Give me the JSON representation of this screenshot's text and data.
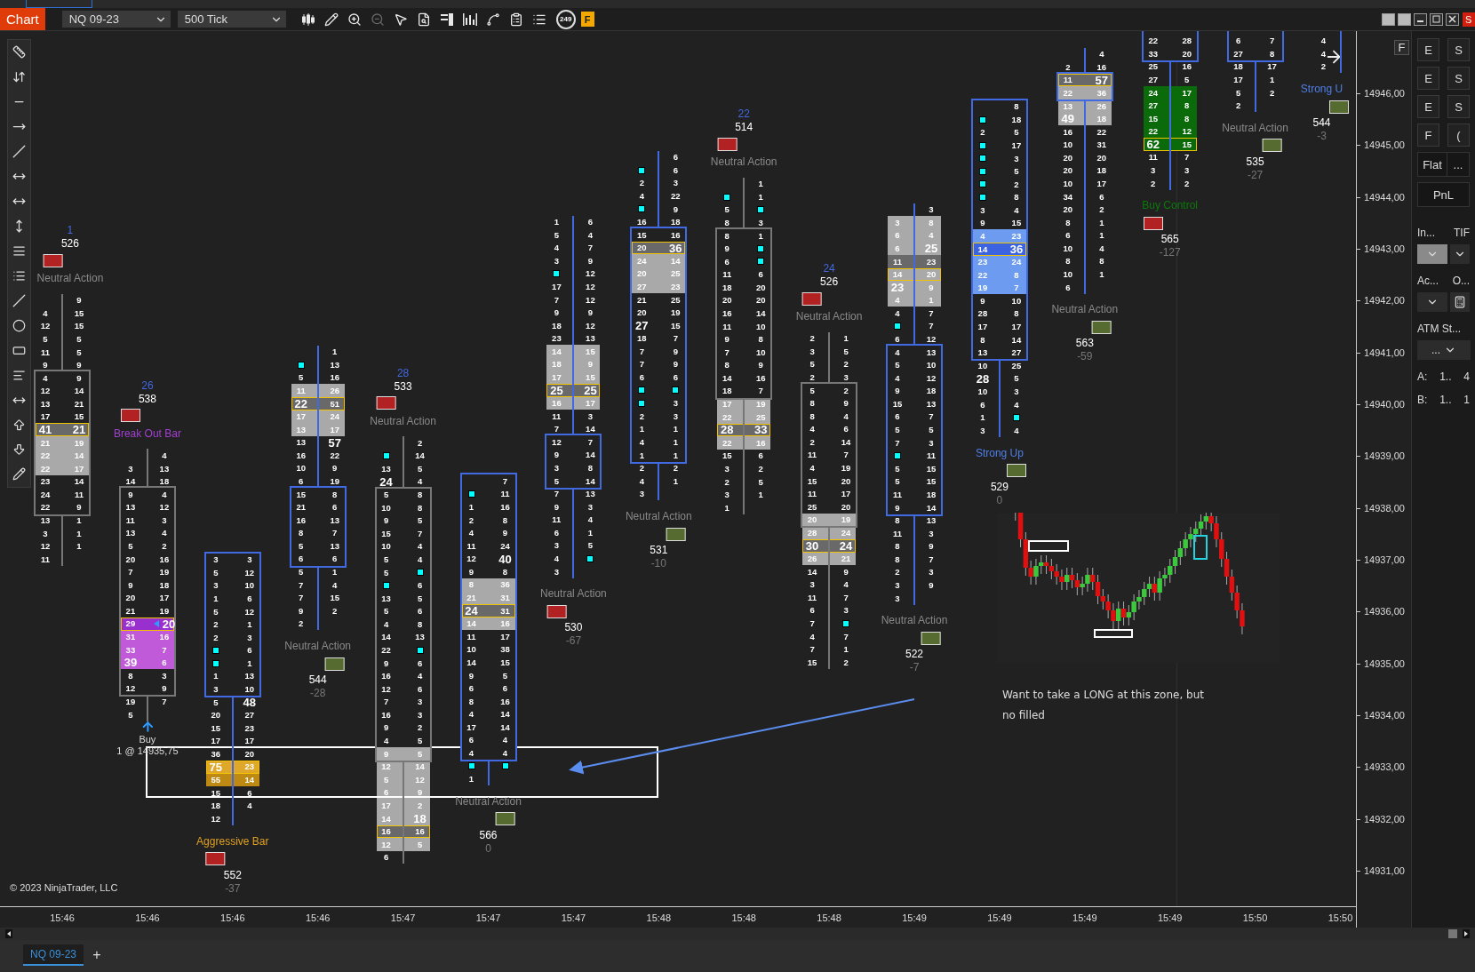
{
  "window": {
    "corner_label": "S"
  },
  "toolbar": {
    "title": "Chart",
    "instrument": "NQ 09-23",
    "interval": "500 Tick",
    "bar_counter": "249",
    "flag": "F"
  },
  "chart": {
    "bars": [
      {
        "up": false,
        "upper": [
          {
            "ask": "9"
          },
          {
            "bid": "4",
            "ask": "15"
          },
          {
            "bid": "12",
            "ask": "15"
          },
          {
            "bid": "5",
            "ask": "5"
          },
          {
            "bid": "11",
            "ask": "5"
          },
          {
            "bid": "9",
            "ask": "9"
          }
        ],
        "body": [
          {
            "bid": "4",
            "ask": "9"
          },
          {
            "bid": "12",
            "ask": "14"
          },
          {
            "bid": "13",
            "ask": "21"
          },
          {
            "bid": "17",
            "ask": "15"
          },
          {
            "bid": "41",
            "ask": "21",
            "kind": "poc",
            "bid_bold": true,
            "ask_bold": true
          },
          {
            "bid": "21",
            "ask": "19",
            "kind": "light"
          },
          {
            "bid": "22",
            "ask": "14",
            "kind": "light"
          },
          {
            "bid": "22",
            "ask": "17",
            "kind": "light"
          },
          {
            "bid": "23",
            "ask": "14"
          },
          {
            "bid": "24",
            "ask": "11"
          },
          {
            "bid": "22",
            "ask": "9"
          }
        ],
        "lower": [
          {
            "bid": "13",
            "ask": "1"
          },
          {
            "bid": "3",
            "ask": "1"
          },
          {
            "bid": "12",
            "ask": "1"
          },
          {
            "bid": "11"
          }
        ],
        "above": {
          "count": "1",
          "volume": "526",
          "color": "#b22222",
          "label": {
            "text": "Neutral Action",
            "color": "#8a8a8a"
          }
        }
      },
      {
        "up": false,
        "upper": [
          {
            "ask": "4"
          },
          {
            "bid": "3",
            "ask": "13"
          },
          {
            "bid": "14",
            "ask": "18"
          }
        ],
        "body": [
          {
            "bid": "9",
            "ask": "4"
          },
          {
            "bid": "13",
            "ask": "12"
          },
          {
            "bid": "11",
            "ask": "3"
          },
          {
            "bid": "13",
            "ask": "4"
          },
          {
            "bid": "5",
            "ask": "2"
          },
          {
            "bid": "20",
            "ask": "16"
          },
          {
            "bid": "7",
            "ask": "19"
          },
          {
            "bid": "9",
            "ask": "18"
          },
          {
            "bid": "20",
            "ask": "17"
          },
          {
            "bid": "21",
            "ask": "19"
          },
          {
            "bid": "29",
            "ask": "20",
            "kind": "purple_poc",
            "ask_bold": true,
            "pointer": true
          },
          {
            "bid": "31",
            "ask": "16",
            "kind": "purple"
          },
          {
            "bid": "33",
            "ask": "7",
            "kind": "purple"
          },
          {
            "bid": "39",
            "ask": "6",
            "kind": "purple",
            "bid_bold": true
          },
          {
            "bid": "8",
            "ask": "3"
          },
          {
            "bid": "12",
            "ask": "9"
          }
        ],
        "lower": [
          {
            "bid": "19",
            "ask": "7"
          },
          {
            "bid": "5"
          }
        ],
        "above": {
          "count": "26",
          "volume": "538",
          "color": "#b22222",
          "label": {
            "text": "Break Out Bar",
            "color": "#a040d0"
          }
        },
        "order": {
          "side": "Buy",
          "fill": "1 @ 14935,75"
        }
      },
      {
        "up": true,
        "body": [
          {
            "bid": "3",
            "ask": "3"
          },
          {
            "bid": "5",
            "ask": "12"
          },
          {
            "bid": "3",
            "ask": "10"
          },
          {
            "bid": "1",
            "ask": "6"
          },
          {
            "bid": "5",
            "ask": "12"
          },
          {
            "bid": "2",
            "ask": "1"
          },
          {
            "bid": "2",
            "ask": "3"
          },
          {
            "bid_marker": true,
            "ask": "6"
          },
          {
            "bid_marker": true,
            "ask": "1"
          },
          {
            "bid": "1",
            "ask": "13"
          },
          {
            "bid": "3",
            "ask": "10"
          }
        ],
        "lower": [
          {
            "bid": "5",
            "ask": "48",
            "ask_bold": true
          },
          {
            "bid": "20",
            "ask": "27"
          },
          {
            "bid": "15",
            "ask": "23"
          },
          {
            "bid": "17",
            "ask": "17"
          },
          {
            "bid": "36",
            "ask": "20"
          },
          {
            "bid": "75",
            "ask": "23",
            "kind": "orange_poc",
            "bid_bold": true
          },
          {
            "bid": "55",
            "ask": "14",
            "kind": "orange"
          },
          {
            "bid": "15",
            "ask": "6"
          },
          {
            "bid": "18",
            "ask": "4"
          },
          {
            "bid": "12"
          }
        ],
        "below": {
          "label": {
            "text": "Aggressive Bar",
            "color": "#e0a020"
          },
          "color": "#b22222",
          "volume": "552",
          "delta": "-37"
        }
      },
      {
        "up": true,
        "upper": [
          {
            "ask": "1"
          },
          {
            "bid_marker": true,
            "ask": "13"
          },
          {
            "bid": "5",
            "ask": "16"
          },
          {
            "bid": "11",
            "ask": "26",
            "kind": "light"
          },
          {
            "bid": "22",
            "ask": "51",
            "kind": "poc",
            "bid_bold": true
          },
          {
            "bid": "17",
            "ask": "24",
            "kind": "light"
          },
          {
            "bid": "13",
            "ask": "17",
            "kind": "light"
          },
          {
            "bid": "13",
            "ask": "57",
            "ask_bold": true
          },
          {
            "bid": "16",
            "ask": "22"
          },
          {
            "bid": "10",
            "ask": "9"
          },
          {
            "bid": "6",
            "ask": "19"
          }
        ],
        "body": [
          {
            "bid": "15",
            "ask": "8"
          },
          {
            "bid": "21",
            "ask": "6"
          },
          {
            "bid": "16",
            "ask": "13"
          },
          {
            "bid": "8",
            "ask": "7"
          },
          {
            "bid": "5",
            "ask": "13"
          },
          {
            "bid": "6",
            "ask": "6"
          }
        ],
        "lower": [
          {
            "bid": "5",
            "ask": "1"
          },
          {
            "bid": "7",
            "ask": "4"
          },
          {
            "bid": "7",
            "ask": "15"
          },
          {
            "bid": "9",
            "ask": "2"
          },
          {
            "bid": "2"
          }
        ],
        "below": {
          "label": {
            "text": "Neutral Action",
            "color": "#8a8a8a"
          },
          "color": "#556b2f",
          "volume": "544",
          "delta": "-28"
        }
      },
      {
        "up": false,
        "upper": [
          {
            "ask": "2"
          },
          {
            "bid_marker": true,
            "ask": "14"
          },
          {
            "bid": "13",
            "ask": "5"
          },
          {
            "bid": "24",
            "ask": "4",
            "bid_bold": true
          }
        ],
        "body": [
          {
            "bid": "5",
            "ask": "8"
          },
          {
            "bid": "10",
            "ask": "8"
          },
          {
            "bid": "9",
            "ask": "5"
          },
          {
            "bid": "15",
            "ask": "7"
          },
          {
            "bid": "10",
            "ask": "4"
          },
          {
            "bid": "5",
            "ask": "4"
          },
          {
            "bid": "5",
            "ask_marker": true
          },
          {
            "bid_marker": true,
            "ask": "6"
          },
          {
            "bid": "13",
            "ask": "5"
          },
          {
            "bid": "5",
            "ask": "6"
          },
          {
            "bid": "4",
            "ask": "8"
          },
          {
            "bid": "14",
            "ask": "13"
          },
          {
            "bid": "22",
            "ask_marker": true
          },
          {
            "bid": "9",
            "ask": "6"
          },
          {
            "bid": "16",
            "ask": "4"
          },
          {
            "bid": "12",
            "ask": "6"
          },
          {
            "bid": "7",
            "ask": "3"
          },
          {
            "bid": "16",
            "ask": "3"
          },
          {
            "bid": "9",
            "ask": "2"
          },
          {
            "bid": "4",
            "ask": "5"
          },
          {
            "bid": "9",
            "ask": "5",
            "kind": "light"
          }
        ],
        "lower": [
          {
            "bid": "12",
            "ask": "14",
            "kind": "light"
          },
          {
            "bid": "5",
            "ask": "12",
            "kind": "light"
          },
          {
            "bid": "6",
            "ask": "9",
            "kind": "light"
          },
          {
            "bid": "17",
            "ask": "2",
            "kind": "light"
          },
          {
            "bid": "14",
            "ask": "18",
            "kind": "light",
            "ask_bold": true
          },
          {
            "bid": "16",
            "ask": "16",
            "kind": "poc"
          },
          {
            "bid": "12",
            "ask": "5",
            "kind": "light"
          },
          {
            "bid": "6"
          }
        ],
        "above": {
          "count": "28",
          "volume": "533",
          "color": "#b22222",
          "label": {
            "text": "Neutral Action",
            "color": "#8a8a8a"
          }
        }
      },
      {
        "up": true,
        "body": [
          {
            "ask": "7"
          },
          {
            "bid_marker": true,
            "ask": "11"
          },
          {
            "bid": "1",
            "ask": "16"
          },
          {
            "bid": "2",
            "ask": "8"
          },
          {
            "bid": "4",
            "ask": "9"
          },
          {
            "bid": "11",
            "ask": "24"
          },
          {
            "bid": "12",
            "ask": "40",
            "ask_bold": true
          },
          {
            "bid": "9",
            "ask": "8"
          },
          {
            "bid": "8",
            "ask": "36",
            "kind": "light"
          },
          {
            "bid": "21",
            "ask": "31",
            "kind": "light"
          },
          {
            "bid": "24",
            "ask": "31",
            "kind": "poc",
            "bid_bold": true
          },
          {
            "bid": "14",
            "ask": "16",
            "kind": "light"
          },
          {
            "bid": "11",
            "ask": "17"
          },
          {
            "bid": "10",
            "ask": "38"
          },
          {
            "bid": "14",
            "ask": "15"
          },
          {
            "bid": "9",
            "ask": "5"
          },
          {
            "bid": "6",
            "ask": "6"
          },
          {
            "bid": "8",
            "ask": "16"
          },
          {
            "bid": "4",
            "ask": "14"
          },
          {
            "bid": "17",
            "ask": "14"
          },
          {
            "bid": "6",
            "ask": "4"
          },
          {
            "bid": "4",
            "ask": "4"
          }
        ],
        "lower": [
          {
            "bid_marker": true,
            "ask_marker": true
          },
          {
            "bid": "1"
          }
        ],
        "below": {
          "label": {
            "text": "Neutral Action",
            "color": "#8a8a8a"
          },
          "color": "#556b2f",
          "volume": "566",
          "delta": "0"
        }
      },
      {
        "up": true,
        "upper": [
          {
            "bid": "1",
            "ask": "6"
          },
          {
            "bid": "5",
            "ask": "4"
          },
          {
            "bid": "4",
            "ask": "7"
          },
          {
            "bid": "3",
            "ask": "9"
          },
          {
            "bid_marker": true,
            "ask": "12"
          },
          {
            "bid": "17",
            "ask": "12"
          },
          {
            "bid": "7",
            "ask": "12"
          },
          {
            "bid": "9",
            "ask": "9"
          },
          {
            "bid": "18",
            "ask": "12"
          },
          {
            "bid": "23",
            "ask": "13"
          },
          {
            "bid": "14",
            "ask": "15",
            "kind": "light"
          },
          {
            "bid": "18",
            "ask": "9",
            "kind": "light"
          },
          {
            "bid": "17",
            "ask": "15",
            "kind": "light"
          },
          {
            "bid": "25",
            "ask": "25",
            "kind": "poc",
            "bid_bold": true,
            "ask_bold": true
          },
          {
            "bid": "16",
            "ask": "17",
            "kind": "light"
          },
          {
            "bid": "11",
            "ask": "3"
          },
          {
            "bid": "7",
            "ask": "14"
          }
        ],
        "body": [
          {
            "bid": "12",
            "ask": "7"
          },
          {
            "bid": "9",
            "ask": "14"
          },
          {
            "bid": "3",
            "ask": "8"
          },
          {
            "bid": "5",
            "ask": "14"
          }
        ],
        "lower": [
          {
            "bid": "7",
            "ask": "13"
          },
          {
            "bid": "9",
            "ask": "3"
          },
          {
            "bid": "11",
            "ask": "4"
          },
          {
            "bid": "6",
            "ask": "1"
          },
          {
            "bid": "3",
            "ask": "5"
          },
          {
            "bid": "4",
            "ask_marker": true
          },
          {
            "bid": "3"
          }
        ],
        "below": {
          "label": {
            "text": "Neutral Action",
            "color": "#8a8a8a"
          },
          "color": "#b22222",
          "volume": "530",
          "delta": "-67"
        }
      },
      {
        "up": true,
        "upper": [
          {
            "ask": "6"
          },
          {
            "bid_marker": true,
            "ask": "6"
          },
          {
            "bid": "2",
            "ask": "3"
          },
          {
            "bid": "4",
            "ask": "22"
          },
          {
            "bid_marker": true,
            "ask": "9"
          },
          {
            "bid": "16",
            "ask": "18"
          }
        ],
        "body": [
          {
            "bid": "15",
            "ask": "16"
          },
          {
            "bid": "20",
            "ask": "36",
            "kind": "poc",
            "ask_bold": true
          },
          {
            "bid": "24",
            "ask": "14",
            "kind": "light"
          },
          {
            "bid": "20",
            "ask": "25",
            "kind": "light"
          },
          {
            "bid": "27",
            "ask": "23",
            "kind": "light"
          },
          {
            "bid": "21",
            "ask": "25"
          },
          {
            "bid": "20",
            "ask": "19"
          },
          {
            "bid": "27",
            "ask": "15",
            "bid_bold": true
          },
          {
            "bid": "18",
            "ask": "7"
          },
          {
            "bid": "7",
            "ask": "9"
          },
          {
            "bid": "7",
            "ask": "9"
          },
          {
            "bid": "6",
            "ask": "6"
          },
          {
            "bid_marker": true,
            "ask_marker": true
          },
          {
            "bid_marker": true,
            "ask": "3"
          },
          {
            "bid": "2",
            "ask": "3"
          },
          {
            "bid": "1",
            "ask": "1"
          },
          {
            "bid": "4",
            "ask": "1"
          },
          {
            "bid": "1",
            "ask": "1"
          }
        ],
        "lower": [
          {
            "bid": "2",
            "ask": "2"
          },
          {
            "bid": "4",
            "ask": "1"
          },
          {
            "bid": "3"
          }
        ],
        "below": {
          "label": {
            "text": "Neutral Action",
            "color": "#8a8a8a"
          },
          "color": "#556b2f",
          "volume": "531",
          "delta": "-10"
        }
      },
      {
        "up": false,
        "upper": [
          {
            "ask": "1"
          },
          {
            "bid_marker": true,
            "ask": "1"
          },
          {
            "bid": "5",
            "ask_marker": true
          },
          {
            "bid": "8",
            "ask": "3"
          }
        ],
        "body": [
          {
            "bid": "8",
            "ask": "1"
          },
          {
            "bid": "9",
            "ask_marker": true
          },
          {
            "bid": "6",
            "ask_marker": true
          },
          {
            "bid": "11",
            "ask": "6"
          },
          {
            "bid": "18",
            "ask": "20"
          },
          {
            "bid": "20",
            "ask": "20"
          },
          {
            "bid": "16",
            "ask": "14"
          },
          {
            "bid": "11",
            "ask": "10"
          },
          {
            "bid": "9",
            "ask": "8"
          },
          {
            "bid": "7",
            "ask": "10"
          },
          {
            "bid": "8",
            "ask": "9"
          },
          {
            "bid": "14",
            "ask": "16"
          },
          {
            "bid": "18",
            "ask": "7"
          }
        ],
        "lower": [
          {
            "bid": "17",
            "ask": "19",
            "kind": "light"
          },
          {
            "bid": "22",
            "ask": "25",
            "kind": "light"
          },
          {
            "bid": "28",
            "ask": "33",
            "kind": "poc",
            "bid_bold": true,
            "ask_bold": true
          },
          {
            "bid": "22",
            "ask": "16",
            "kind": "light"
          },
          {
            "bid": "15",
            "ask": "6"
          },
          {
            "bid": "3",
            "ask": "2"
          },
          {
            "bid": "2",
            "ask": "5"
          },
          {
            "bid": "3",
            "ask": "1"
          },
          {
            "bid": "1"
          }
        ],
        "above": {
          "count": "22",
          "volume": "514",
          "color": "#b22222",
          "label": {
            "text": "Neutral Action",
            "color": "#8a8a8a"
          }
        }
      },
      {
        "up": false,
        "upper": [
          {
            "bid": "2",
            "ask": "1"
          },
          {
            "bid": "3",
            "ask": "5"
          },
          {
            "bid": "5",
            "ask": "2"
          },
          {
            "bid": "2",
            "ask": "3"
          }
        ],
        "body": [
          {
            "bid": "5",
            "ask": "2"
          },
          {
            "bid": "8",
            "ask": "9"
          },
          {
            "bid": "8",
            "ask": "4"
          },
          {
            "bid": "4",
            "ask": "6"
          },
          {
            "bid": "2",
            "ask": "14"
          },
          {
            "bid": "11",
            "ask": "7"
          },
          {
            "bid": "4",
            "ask": "19"
          },
          {
            "bid": "15",
            "ask": "20"
          },
          {
            "bid": "11",
            "ask": "17"
          },
          {
            "bid": "25",
            "ask": "20"
          },
          {
            "bid": "20",
            "ask": "19",
            "kind": "light"
          }
        ],
        "lower": [
          {
            "bid": "28",
            "ask": "24",
            "kind": "light"
          },
          {
            "bid": "30",
            "ask": "24",
            "kind": "poc",
            "bid_bold": true,
            "ask_bold": true
          },
          {
            "bid": "26",
            "ask": "21",
            "kind": "light"
          },
          {
            "bid": "14",
            "ask": "9"
          },
          {
            "bid": "3",
            "ask": "4"
          },
          {
            "bid": "11",
            "ask": "7"
          },
          {
            "bid": "6",
            "ask": "3"
          },
          {
            "bid": "7",
            "ask_marker": true
          },
          {
            "bid": "4",
            "ask": "7"
          },
          {
            "bid": "7",
            "ask": "1"
          },
          {
            "bid": "15",
            "ask": "2"
          }
        ],
        "above": {
          "count": "24",
          "volume": "526",
          "color": "#b22222",
          "label": {
            "text": "Neutral Action",
            "color": "#8a8a8a"
          }
        }
      },
      {
        "up": true,
        "upper": [
          {
            "ask": "3"
          },
          {
            "bid": "3",
            "ask": "8",
            "kind": "light"
          },
          {
            "bid": "6",
            "ask": "4",
            "kind": "light"
          },
          {
            "bid": "6",
            "ask": "25",
            "kind": "light",
            "ask_bold": true
          },
          {
            "bid": "11",
            "ask": "23",
            "kind": "dark"
          },
          {
            "bid": "14",
            "ask": "20",
            "kind": "poc_light"
          },
          {
            "bid": "23",
            "ask": "9",
            "kind": "light",
            "bid_bold": true
          },
          {
            "bid": "4",
            "ask": "1",
            "kind": "light"
          },
          {
            "bid": "4",
            "ask": "7"
          },
          {
            "bid_marker": true,
            "ask": "7"
          },
          {
            "bid": "6",
            "ask": "12"
          }
        ],
        "body": [
          {
            "bid": "4",
            "ask": "13"
          },
          {
            "bid": "5",
            "ask": "10"
          },
          {
            "bid": "4",
            "ask": "12"
          },
          {
            "bid": "9",
            "ask": "18"
          },
          {
            "bid": "15",
            "ask": "13"
          },
          {
            "bid": "6",
            "ask": "7"
          },
          {
            "bid": "5",
            "ask": "5"
          },
          {
            "bid": "7",
            "ask": "3"
          },
          {
            "bid_marker": true,
            "ask": "11"
          },
          {
            "bid": "5",
            "ask": "15"
          },
          {
            "bid": "5",
            "ask": "15"
          },
          {
            "bid": "11",
            "ask": "18"
          },
          {
            "bid": "9",
            "ask": "14"
          }
        ],
        "lower": [
          {
            "bid": "8",
            "ask": "13"
          },
          {
            "bid": "11",
            "ask": "3"
          },
          {
            "bid": "8",
            "ask": "9"
          },
          {
            "bid": "8",
            "ask": "7"
          },
          {
            "bid": "2",
            "ask": "3"
          },
          {
            "bid": "3",
            "ask": "9"
          },
          {
            "bid": "3"
          }
        ],
        "below": {
          "label": {
            "text": "Neutral Action",
            "color": "#8a8a8a"
          },
          "color": "#556b2f",
          "volume": "522",
          "delta": "-7"
        }
      },
      {
        "up": true,
        "body": [
          {
            "ask": "8"
          },
          {
            "bid_marker": true,
            "ask": "18"
          },
          {
            "bid": "2",
            "ask": "5"
          },
          {
            "bid_marker": true,
            "ask": "17"
          },
          {
            "bid_marker": true,
            "ask": "3"
          },
          {
            "bid_marker": true,
            "ask": "5"
          },
          {
            "bid_marker": true,
            "ask": "2"
          },
          {
            "bid_marker": true,
            "ask": "8"
          },
          {
            "bid": "3",
            "ask": "4"
          },
          {
            "bid": "9",
            "ask": "15"
          },
          {
            "bid": "4",
            "ask": "23",
            "kind": "blue"
          },
          {
            "bid": "14",
            "ask": "36",
            "kind": "blue_poc",
            "ask_bold": true
          },
          {
            "bid": "23",
            "ask": "24",
            "kind": "blue"
          },
          {
            "bid": "22",
            "ask": "8",
            "kind": "blue"
          },
          {
            "bid": "19",
            "ask": "7",
            "kind": "blue"
          },
          {
            "bid": "9",
            "ask": "10"
          },
          {
            "bid": "28",
            "ask": "8"
          },
          {
            "bid": "17",
            "ask": "17"
          },
          {
            "bid": "8",
            "ask": "14"
          },
          {
            "bid": "13",
            "ask": "27"
          }
        ],
        "lower": [
          {
            "bid": "10",
            "ask": "25"
          },
          {
            "bid": "28",
            "ask": "5",
            "bid_bold": true
          },
          {
            "bid": "10",
            "ask": "3"
          },
          {
            "bid": "6",
            "ask": "4"
          },
          {
            "bid": "1",
            "ask_marker": true
          },
          {
            "bid": "3",
            "ask": "4"
          }
        ],
        "below": {
          "label": {
            "text": "Strong Up",
            "color": "#4f7fe8"
          },
          "color": "#556b2f",
          "volume": "529",
          "delta": "0"
        }
      },
      {
        "up": true,
        "upper": [
          {
            "ask": "4"
          },
          {
            "bid": "2",
            "ask": "16"
          }
        ],
        "body": [
          {
            "bid": "11",
            "ask": "57",
            "kind": "poc",
            "ask_bold": true
          },
          {
            "bid": "22",
            "ask": "36",
            "kind": "light"
          }
        ],
        "lower": [
          {
            "bid": "13",
            "ask": "26",
            "kind": "light"
          },
          {
            "bid": "49",
            "ask": "18",
            "kind": "light",
            "bid_bold": true
          },
          {
            "bid": "16",
            "ask": "22"
          },
          {
            "bid": "10",
            "ask": "31"
          },
          {
            "bid": "20",
            "ask": "20"
          },
          {
            "bid": "20",
            "ask": "18"
          },
          {
            "bid": "10",
            "ask": "17"
          },
          {
            "bid": "34",
            "ask": "6"
          },
          {
            "bid": "20",
            "ask": "2"
          },
          {
            "bid": "8",
            "ask": "1"
          },
          {
            "bid": "6",
            "ask": "1"
          },
          {
            "bid": "10",
            "ask": "4"
          },
          {
            "bid": "8",
            "ask": "8"
          },
          {
            "bid": "10",
            "ask": "1"
          },
          {
            "bid": "6"
          }
        ],
        "below": {
          "label": {
            "text": "Neutral Action",
            "color": "#8a8a8a"
          },
          "color": "#556b2f",
          "volume": "563",
          "delta": "-59"
        }
      },
      {
        "up": true,
        "body": [
          {
            "bid": "22",
            "ask": "28"
          },
          {
            "bid": "33",
            "ask": "20"
          }
        ],
        "lower": [
          {
            "bid": "25",
            "ask": "16"
          },
          {
            "bid": "27",
            "ask": "5"
          },
          {
            "bid": "24",
            "ask": "17",
            "kind": "green"
          },
          {
            "bid": "27",
            "ask": "8",
            "kind": "green"
          },
          {
            "bid": "15",
            "ask": "8",
            "kind": "green"
          },
          {
            "bid": "22",
            "ask": "12",
            "kind": "green"
          },
          {
            "bid": "62",
            "ask": "15",
            "kind": "green_poc",
            "bid_bold": true
          },
          {
            "bid": "11",
            "ask": "7"
          },
          {
            "bid": "3",
            "ask": "3"
          },
          {
            "bid": "2",
            "ask": "2"
          }
        ],
        "below": {
          "label": {
            "text": "Buy Control",
            "color": "#0a7a0a"
          },
          "color": "#b22222",
          "volume": "565",
          "delta": "-127"
        }
      },
      {
        "up": true,
        "body": [
          {
            "bid": "6",
            "ask": "7"
          },
          {
            "bid": "27",
            "ask": "8"
          }
        ],
        "lower": [
          {
            "bid": "18",
            "ask": "17"
          },
          {
            "bid": "17",
            "ask": "1"
          },
          {
            "bid": "5",
            "ask": "2"
          },
          {
            "bid": "2"
          }
        ],
        "below": {
          "label": {
            "text": "Neutral Action",
            "color": "#8a8a8a"
          },
          "color": "#556b2f",
          "volume": "535",
          "delta": "-27"
        }
      },
      {
        "up": true,
        "upper": [
          {
            "bid": "4"
          },
          {
            "bid": "4"
          },
          {
            "bid": "2"
          }
        ],
        "below": {
          "label": {
            "text": "Strong U",
            "color": "#4f7fe8"
          },
          "color": "#556b2f",
          "volume": "544",
          "delta": "-3"
        }
      }
    ],
    "time_labels": [
      "15:46",
      "15:46",
      "15:46",
      "15:46",
      "15:47",
      "15:47",
      "15:47",
      "15:48",
      "15:48",
      "15:48",
      "15:49",
      "15:49",
      "15:49",
      "15:49",
      "15:50",
      "15:50"
    ],
    "price_labels": [
      "14946,00",
      "14945,00",
      "14944,00",
      "14943,00",
      "14942,00",
      "14941,00",
      "14940,00",
      "14939,00",
      "14938,00",
      "14937,00",
      "14936,00",
      "14935,00",
      "14934,00",
      "14933,00",
      "14932,00",
      "14931,00"
    ],
    "corner_button": "F",
    "annotation": "Want to take a LONG at this zone, but no filled",
    "copyright": "© 2023 NinjaTrader, LLC"
  },
  "chart_trader": {
    "buttons": [
      "E",
      "S",
      "E",
      "S",
      "E",
      "S",
      "F",
      "("
    ],
    "position": "Flat",
    "more": "...",
    "pnl": "PnL",
    "instrument_label": "In...",
    "tif_label": "TIF",
    "account_label": "Ac...",
    "order_label": "O...",
    "atm_label": "ATM St...",
    "atm_value": "...",
    "ask_label": "A:",
    "ask_price": "1..",
    "ask_qty": "4",
    "bid_label": "B:",
    "bid_price": "1..",
    "bid_qty": "1"
  },
  "tabs": [
    {
      "label": "NQ 09-23",
      "selected": true
    }
  ],
  "add_tab": "+"
}
